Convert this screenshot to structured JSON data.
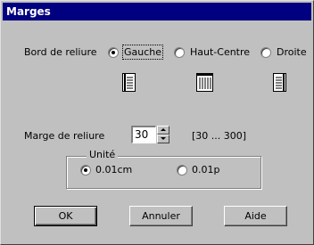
{
  "window": {
    "title": "Marges"
  },
  "binding_edge": {
    "label": "Bord de reliure",
    "options": [
      {
        "label": "Gauche",
        "checked": true
      },
      {
        "label": "Haut-Centre",
        "checked": false
      },
      {
        "label": "Droite",
        "checked": false
      }
    ]
  },
  "icons": [
    "left-binding-page-icon",
    "top-binding-page-icon",
    "right-binding-page-icon"
  ],
  "margin": {
    "label": "Marge de reliure",
    "value": "30",
    "range": "[30 ... 300]"
  },
  "unit": {
    "legend": "Unité",
    "options": [
      {
        "label": "0.01cm",
        "checked": true
      },
      {
        "label": "0.01p",
        "checked": false
      }
    ]
  },
  "buttons": {
    "ok": "OK",
    "cancel": "Annuler",
    "help": "Aide"
  }
}
